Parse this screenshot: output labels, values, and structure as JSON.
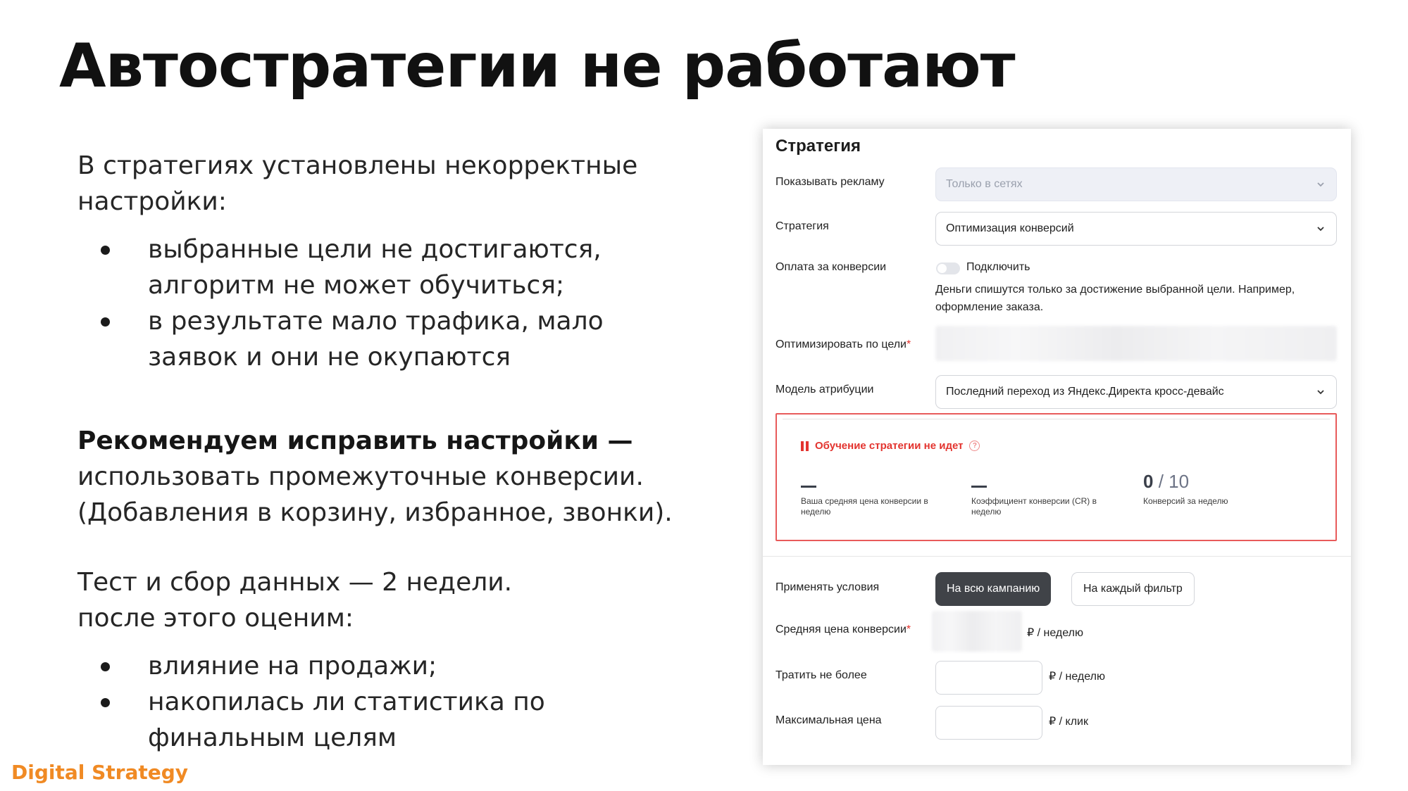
{
  "slide": {
    "title": "Автостратегии не работают",
    "intro": "В стратегиях установлены некорректные настройки:",
    "issues": [
      "выбранные цели не достигаются, алгоритм не может обучиться;",
      "в результате мало трафика, мало заявок и они не окупаются"
    ],
    "recommend_bold": "Рекомендуем исправить настройки —",
    "recommend_text": "использовать промежуточные конверсии. (Добавления в корзину, избранное, звонки).",
    "test_line1": "Тест и сбор данных — 2 недели.",
    "test_line2": "после этого оценим:",
    "evaluate": [
      "влияние на продажи;",
      "накопилась ли статистика по финальным целям"
    ],
    "brand": "Digital Strategy",
    "brand_color": "#f08a24"
  },
  "panel": {
    "title": "Стратегия",
    "show_ads": {
      "label": "Показывать рекламу",
      "value": "Только в сетях"
    },
    "strategy": {
      "label": "Стратегия",
      "value": "Оптимизация конверсий"
    },
    "pay_for_conv": {
      "label": "Оплата за конверсии",
      "toggle_label": "Подключить",
      "toggle_on": false,
      "hint_line1": "Деньги спишутся только за достижение выбранной цели. Например,",
      "hint_line2": "оформление заказа."
    },
    "optimize_goal": {
      "label": "Оптимизировать по цели",
      "required_mark": "*"
    },
    "attribution": {
      "label": "Модель атрибуции",
      "value": "Последний переход из Яндекс.Директа кросс-девайс"
    },
    "learning": {
      "status": "Обучение стратегии не идет",
      "help_glyph": "?",
      "alert_color": "#e3342f",
      "metrics": [
        {
          "value": "—",
          "caption": "Ваша средняя цена конверсии в неделю"
        },
        {
          "value": "—",
          "caption": "Коэффициент конверсии (CR) в неделю"
        },
        {
          "value": "0",
          "of": "/ 10",
          "caption": "Конверсий за неделю"
        }
      ]
    },
    "apply": {
      "label": "Применять условия",
      "option_active": "На всю кампанию",
      "option_other": "На каждый фильтр"
    },
    "avg_price": {
      "label": "Средняя цена конверсии",
      "required_mark": "*",
      "unit": "₽ / неделю"
    },
    "spend_limit": {
      "label": "Тратить не более",
      "value": "",
      "unit": "₽ / неделю"
    },
    "max_price": {
      "label": "Максимальная цена",
      "value": "",
      "unit": "₽ / клик"
    }
  }
}
